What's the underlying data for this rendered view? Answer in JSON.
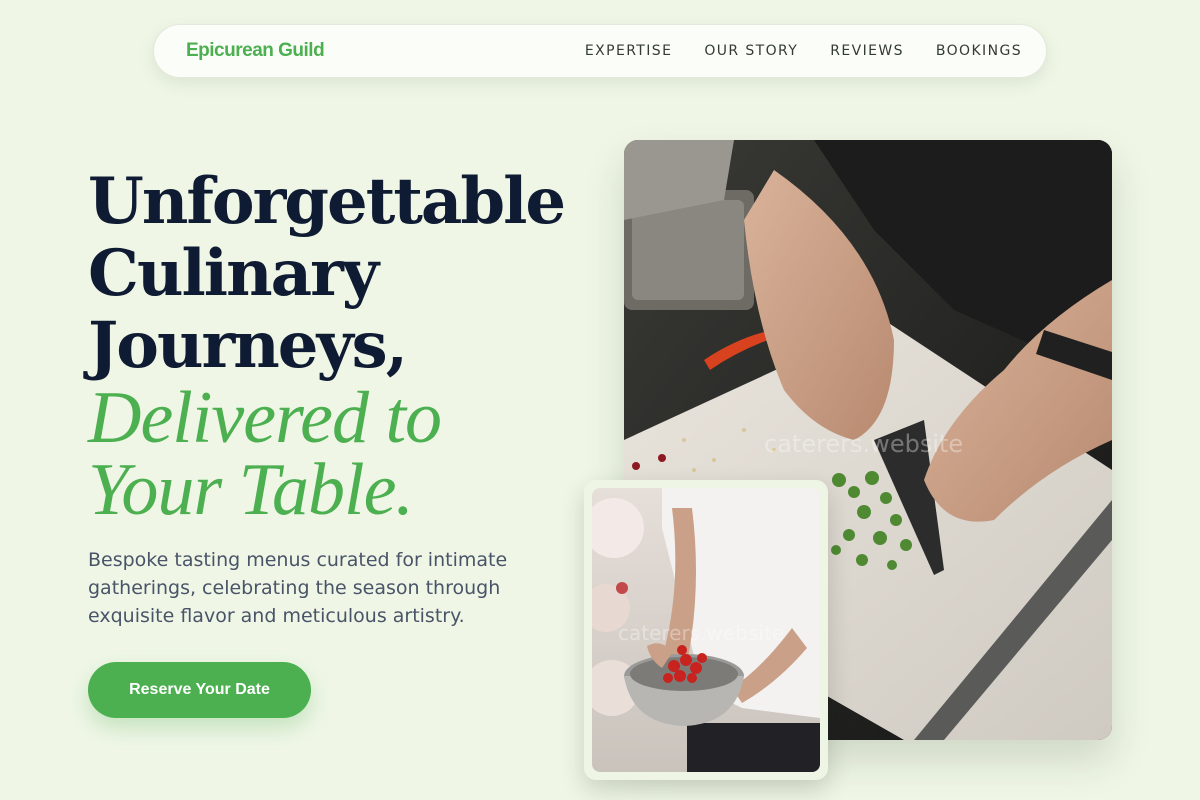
{
  "brand": {
    "name": "Epicurean Guild"
  },
  "nav": {
    "links": [
      "EXPERTISE",
      "OUR STORY",
      "REVIEWS",
      "BOOKINGS"
    ]
  },
  "hero": {
    "title_lines": [
      "Unforgettable",
      "Culinary",
      "Journeys,"
    ],
    "accent_lines": [
      "Delivered to",
      "Your Table."
    ],
    "subtitle": "Bespoke tasting menus curated for intimate gatherings, celebrating the season through exquisite flavor and meticulous artistry.",
    "cta_label": "Reserve Your Date"
  },
  "images": {
    "main_watermark": "caterers.website",
    "small_watermark": "caterers.website"
  },
  "colors": {
    "background": "#eff6e6",
    "accent": "#4caf50",
    "heading": "#0f1b33",
    "body_text": "#4a5468"
  }
}
